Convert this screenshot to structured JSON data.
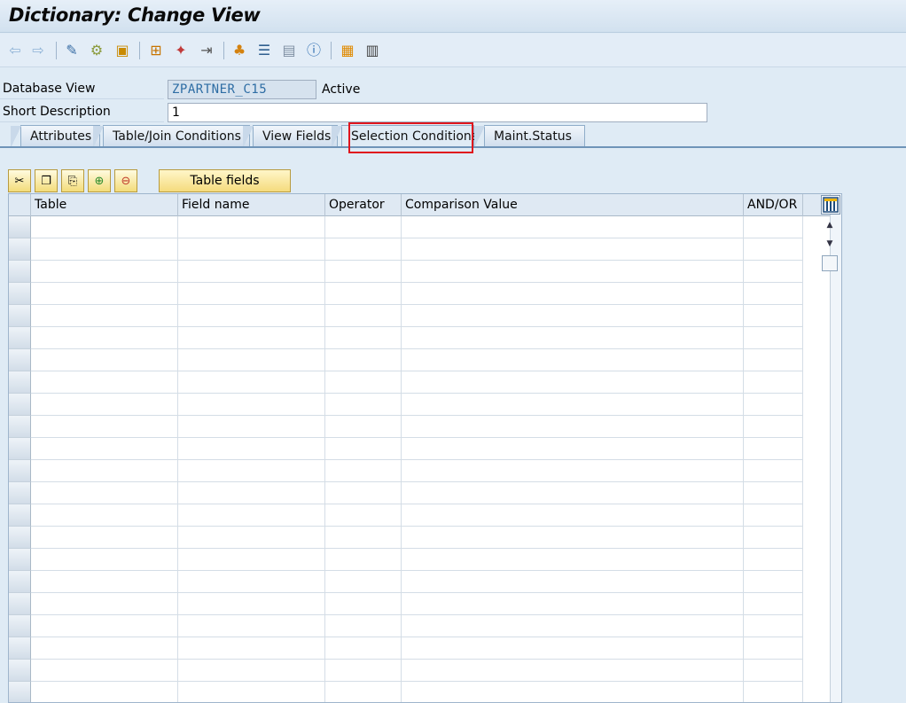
{
  "window": {
    "title": "Dictionary: Change View"
  },
  "toolbar": {
    "icons": [
      "back-icon",
      "forward-icon",
      "other-object-icon",
      "display-change-icon",
      "activate-icon",
      "where-used-icon",
      "object-list-icon",
      "graphic-icon",
      "hierarchy-icon",
      "technical-settings-icon",
      "utilities-icon",
      "info-icon",
      "layout-icon",
      "table-icon"
    ]
  },
  "form": {
    "database_view_label": "Database View",
    "database_view_value": "ZPARTNER_C15",
    "status": "Active",
    "short_description_label": "Short Description",
    "short_description_value": "1"
  },
  "tabs": [
    {
      "label": "Attributes"
    },
    {
      "label": "Table/Join Conditions"
    },
    {
      "label": "View Fields"
    },
    {
      "label": "Selection Conditions",
      "active": true
    },
    {
      "label": "Maint.Status"
    }
  ],
  "table_toolbar": {
    "buttons": [
      "cut-icon",
      "copy-icon",
      "paste-icon",
      "insert-row-icon",
      "delete-row-icon"
    ],
    "table_fields_label": "Table fields"
  },
  "grid": {
    "columns": [
      "Table",
      "Field name",
      "Operator",
      "Comparison Value",
      "AND/OR"
    ],
    "row_count": 22
  },
  "colors": {
    "highlight": "#e0151d",
    "background": "#dfebf5"
  }
}
